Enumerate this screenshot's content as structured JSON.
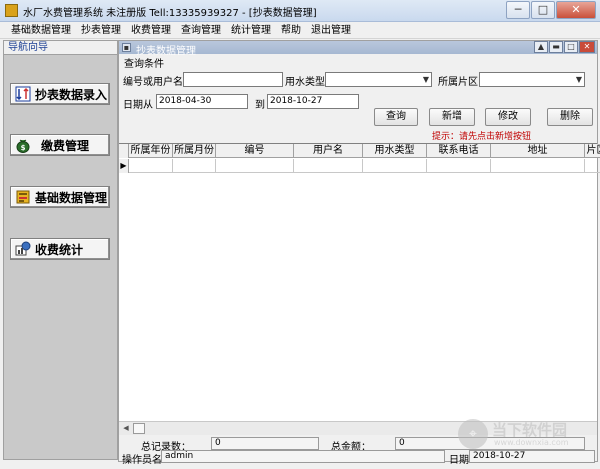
{
  "window": {
    "title": "水厂水费管理系统 未注册版 Tell:13335939327  - [抄表数据管理]",
    "minimize": "─",
    "maximize": "□",
    "close": "✕"
  },
  "menu": [
    "基础数据管理",
    "抄表管理",
    "收费管理",
    "查询管理",
    "统计管理",
    "帮助",
    "退出管理"
  ],
  "nav": {
    "header": "导航向导",
    "items": [
      {
        "label": "抄表数据录入",
        "icon": "meter-entry-icon"
      },
      {
        "label": "缴费管理",
        "icon": "money-bag-icon"
      },
      {
        "label": "基础数据管理",
        "icon": "database-icon"
      },
      {
        "label": "收费统计",
        "icon": "statistics-icon"
      }
    ]
  },
  "child": {
    "title": "抄表数据管理",
    "min": "▲",
    "restore": "▬",
    "max": "□",
    "close": "✕"
  },
  "query": {
    "group": "查询条件",
    "code_label": "编号或用户名",
    "code_value": "",
    "water_type_label": "用水类型",
    "water_type_value": "",
    "area_label": "所属片区",
    "area_value": "",
    "date_from_label": "日期从",
    "date_from": "2018-04-30",
    "date_to_label": "到",
    "date_to": "2018-10-27",
    "btn_query": "查询",
    "btn_add": "新增",
    "btn_edit": "修改",
    "btn_delete": "删除",
    "hint": "提示：请先点击新增按钮"
  },
  "grid": {
    "columns": [
      "所属年份",
      "所属月份",
      "编号",
      "用户名",
      "用水类型",
      "联系电话",
      "地址",
      "片区"
    ],
    "row_indicator": "▶"
  },
  "summary": {
    "total_records_label": "总记录数：",
    "total_records": "0",
    "total_amount_label": "总金额：",
    "total_amount": "0"
  },
  "statusbar": {
    "operator_label": "操作员名",
    "operator": "admin",
    "date_label": "日期",
    "date": "2018-10-27"
  },
  "watermark": {
    "text": "当下软件园",
    "url": "www.downxia.com",
    "glyph": "⌖"
  },
  "colors": {
    "hint": "#c00000",
    "nav_header": "#1c3f94",
    "child_titlebar": "#a6b8d2"
  }
}
